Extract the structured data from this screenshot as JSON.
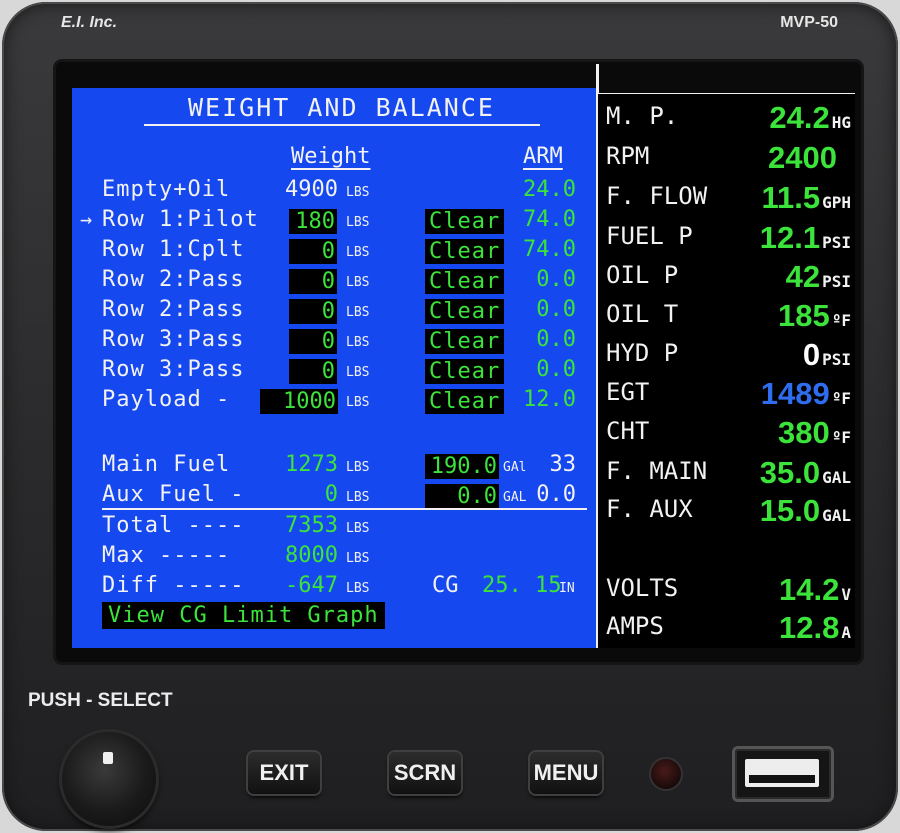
{
  "device": {
    "brand": "E.I. Inc.",
    "model": "MVP-50"
  },
  "screen": {
    "title": "WEIGHT AND BALANCE",
    "col_weight": "Weight",
    "col_arm": "ARM",
    "unit_lbs": "LBS",
    "clear_label": "Clear",
    "selected_marker": "→",
    "rows": [
      {
        "label": "Empty+Oil",
        "weight": "4900",
        "arm": "24.0",
        "editable": false
      },
      {
        "label": "Row 1:Pilot",
        "weight": "180",
        "arm": "74.0",
        "editable": true,
        "selected": true
      },
      {
        "label": "Row 1:Cplt",
        "weight": "0",
        "arm": "74.0",
        "editable": true
      },
      {
        "label": "Row 2:Pass",
        "weight": "0",
        "arm": "0.0",
        "editable": true
      },
      {
        "label": "Row 2:Pass",
        "weight": "0",
        "arm": "0.0",
        "editable": true
      },
      {
        "label": "Row 3:Pass",
        "weight": "0",
        "arm": "0.0",
        "editable": true
      },
      {
        "label": "Row 3:Pass",
        "weight": "0",
        "arm": "0.0",
        "editable": true
      },
      {
        "label": "Payload -",
        "weight": "1000",
        "arm": "12.0",
        "editable": true
      }
    ],
    "fuel": [
      {
        "label": "Main Fuel",
        "weight": "1273",
        "gal": "190.0",
        "gal_unit": "GAl",
        "arm": "33"
      },
      {
        "label": "Aux Fuel -",
        "weight": "0",
        "gal": "0.0",
        "gal_unit": "GAL",
        "arm": "0.0"
      }
    ],
    "totals": [
      {
        "label": "Total ----",
        "value": "7353"
      },
      {
        "label": "Max -----",
        "value": "8000"
      },
      {
        "label": "Diff -----",
        "value": "-647"
      }
    ],
    "cg": {
      "label": "CG",
      "value": "25. 15",
      "unit": "IN"
    },
    "cg_graph_button": "View CG Limit Graph"
  },
  "engine": [
    {
      "label": "M. P.",
      "value": "24.2",
      "unit": "HG"
    },
    {
      "label": "RPM",
      "value": "2400",
      "unit": ""
    },
    {
      "label": "F. FLOW",
      "value": "11.5",
      "unit": "GPH"
    },
    {
      "label": "FUEL P",
      "value": "12.1",
      "unit": "PSI"
    },
    {
      "label": "OIL P",
      "value": "42",
      "unit": "PSI"
    },
    {
      "label": "OIL T",
      "value": "185",
      "unit": "ºF"
    },
    {
      "label": "HYD P",
      "value": "0",
      "unit": "PSI"
    },
    {
      "label": "EGT",
      "value": "1489",
      "unit": "ºF"
    },
    {
      "label": "CHT",
      "value": "380",
      "unit": "ºF"
    },
    {
      "label": "F. MAIN",
      "value": "35.0",
      "unit": "GAL"
    },
    {
      "label": "F. AUX",
      "value": "15.0",
      "unit": "GAL"
    },
    {
      "label": "VOLTS",
      "value": "14.2",
      "unit": "V"
    },
    {
      "label": "AMPS",
      "value": "12.8",
      "unit": "A"
    }
  ],
  "colors": {
    "screen_blue": "#1648f0",
    "value_green": "#3be33b",
    "egt_blue": "#2e6df0",
    "hyd_white": "#ffffff"
  },
  "controls": {
    "push_select": "PUSH - SELECT",
    "exit": "EXIT",
    "scrn": "SCRN",
    "menu": "MENU"
  }
}
